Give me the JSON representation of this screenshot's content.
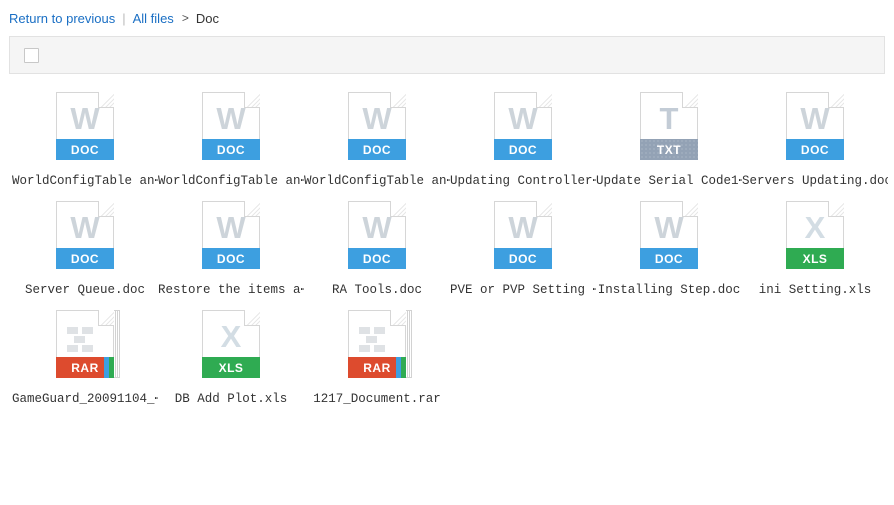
{
  "breadcrumb": {
    "return_label": "Return to previous",
    "separator": "|",
    "all_files_label": "All files",
    "arrow": ">",
    "current": "Doc"
  },
  "toolbar": {
    "select_all_checked": false
  },
  "icon_labels": {
    "doc": "DOC",
    "txt": "TXT",
    "xls": "XLS",
    "rar": "RAR"
  },
  "glyphs": {
    "doc": "W",
    "txt": "T",
    "xls": "X"
  },
  "files": [
    {
      "name": "WorldConfigTable an⋯",
      "type": "doc"
    },
    {
      "name": "WorldConfigTable an⋯",
      "type": "doc"
    },
    {
      "name": "WorldConfigTable an⋯",
      "type": "doc"
    },
    {
      "name": "Updating Controller⋯",
      "type": "doc"
    },
    {
      "name": "Update Serial Code1⋯",
      "type": "txt"
    },
    {
      "name": "Servers Updating.doc",
      "type": "doc"
    },
    {
      "name": "Server Queue.doc",
      "type": "doc"
    },
    {
      "name": "Restore the items a⋯",
      "type": "doc"
    },
    {
      "name": "RA Tools.doc",
      "type": "doc"
    },
    {
      "name": "PVE or PVP Setting ⋯",
      "type": "doc"
    },
    {
      "name": "Installing Step.doc",
      "type": "doc"
    },
    {
      "name": "ini Setting.xls",
      "type": "xls"
    },
    {
      "name": "GameGuard_20091104_⋯",
      "type": "rar"
    },
    {
      "name": "DB Add Plot.xls",
      "type": "xls"
    },
    {
      "name": "1217_Document.rar",
      "type": "rar"
    }
  ],
  "colors": {
    "link": "#1a6fc4",
    "doc_banner": "#3d9fe0",
    "txt_banner": "#93a2b5",
    "xls_banner": "#2fab52",
    "rar_banner": "#dd4b2e",
    "toolbar_bg": "#f5f5f5"
  }
}
